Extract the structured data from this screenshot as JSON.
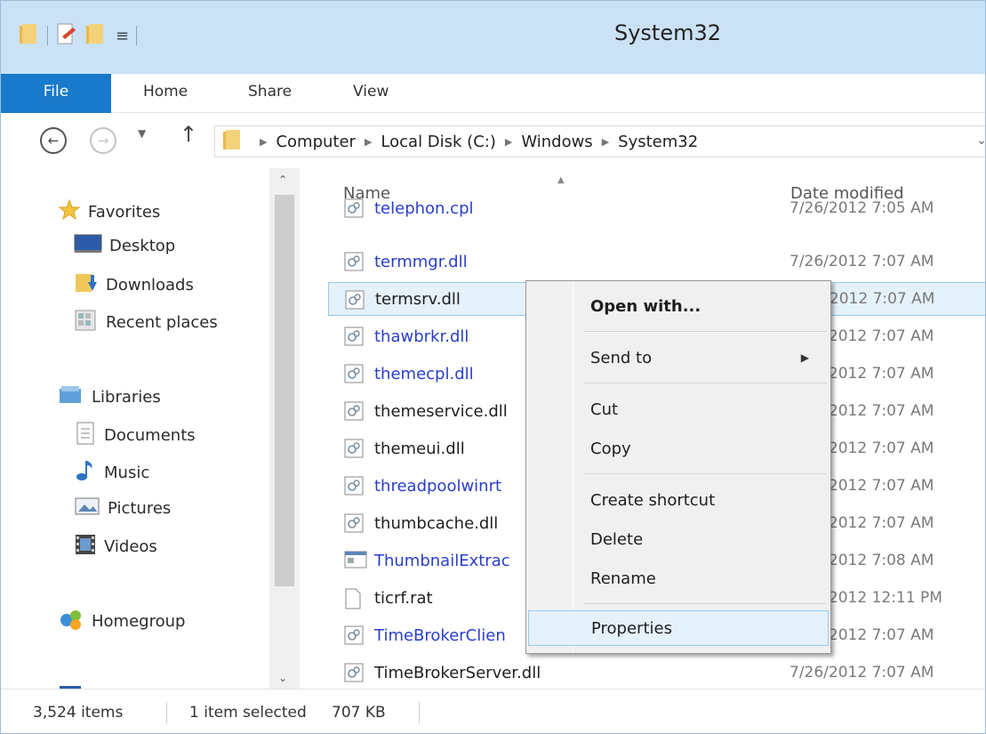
{
  "window": {
    "title": "System32"
  },
  "ribbon": {
    "tabs": [
      {
        "label": "File"
      },
      {
        "label": "Home"
      },
      {
        "label": "Share"
      },
      {
        "label": "View"
      }
    ]
  },
  "address": {
    "crumbs": [
      "Computer",
      "Local Disk (C:)",
      "Windows",
      "System32"
    ]
  },
  "navigation": {
    "favorites": "Favorites",
    "favorite_items": [
      "Desktop",
      "Downloads",
      "Recent places"
    ],
    "libraries": "Libraries",
    "library_items": [
      "Documents",
      "Music",
      "Pictures",
      "Videos"
    ],
    "homegroup": "Homegroup"
  },
  "filelist": {
    "columns": {
      "name": "Name",
      "date": "Date modified"
    },
    "rows": [
      {
        "name": "telephon.cpl",
        "date": "7/26/2012 7:05 AM",
        "color": "blue",
        "icon": "dll-icon"
      },
      {
        "name": "termmgr.dll",
        "date": "7/26/2012 7:07 AM",
        "color": "blue",
        "icon": "dll-icon"
      },
      {
        "name": "termsrv.dll",
        "date": "7/26/2012 7:07 AM",
        "color": "black",
        "icon": "dll-icon",
        "selected": true
      },
      {
        "name": "thawbrkr.dll",
        "date": "7/26/2012 7:07 AM",
        "color": "blue",
        "icon": "dll-icon"
      },
      {
        "name": "themecpl.dll",
        "date": "7/26/2012 7:07 AM",
        "color": "blue",
        "icon": "dll-icon"
      },
      {
        "name": "themeservice.dll",
        "date": "7/26/2012 7:07 AM",
        "color": "black",
        "icon": "dll-icon"
      },
      {
        "name": "themeui.dll",
        "date": "7/26/2012 7:07 AM",
        "color": "black",
        "icon": "dll-icon"
      },
      {
        "name": "threadpoolwinrt",
        "date": "7/26/2012 7:07 AM",
        "color": "blue",
        "icon": "dll-icon"
      },
      {
        "name": "thumbcache.dll",
        "date": "7/26/2012 7:07 AM",
        "color": "black",
        "icon": "dll-icon"
      },
      {
        "name": "ThumbnailExtrac",
        "date": "7/26/2012 7:08 AM",
        "color": "blue",
        "icon": "exe-icon"
      },
      {
        "name": "ticrf.rat",
        "date": "7/26/2012 12:11 PM",
        "color": "black",
        "icon": "file-icon"
      },
      {
        "name": "TimeBrokerClien",
        "date": "7/26/2012 7:07 AM",
        "color": "blue",
        "icon": "dll-icon"
      },
      {
        "name": "TimeBrokerServer.dll",
        "date": "7/26/2012 7:07 AM",
        "color": "black",
        "icon": "dll-icon"
      }
    ]
  },
  "context_menu": {
    "open_with": "Open with...",
    "send_to": "Send to",
    "cut": "Cut",
    "copy": "Copy",
    "create_shortcut": "Create shortcut",
    "delete": "Delete",
    "rename": "Rename",
    "properties": "Properties"
  },
  "status": {
    "item_count": "3,524 items",
    "selection": "1 item selected",
    "size": "707 KB"
  },
  "colors": {
    "file_tab": "#1979ca",
    "titlebar": "#cbe1f6",
    "selection": "#e5f1fb",
    "selection_border": "#99c9ef",
    "link_blue": "#2a3ec9"
  }
}
